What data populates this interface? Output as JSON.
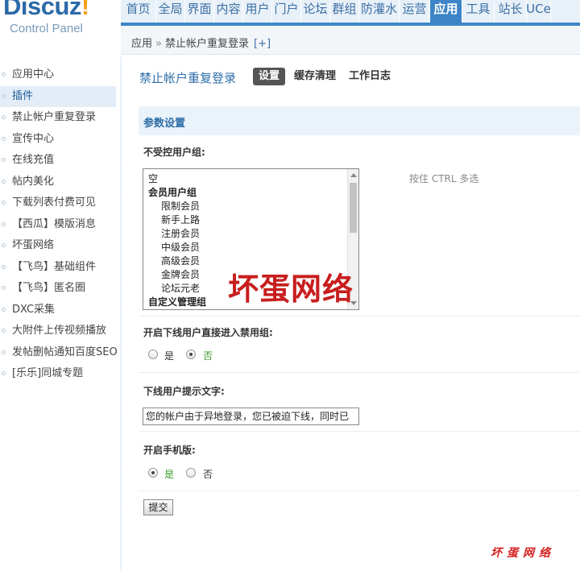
{
  "logo": {
    "brand": "Discuz",
    "brand_mark": "!",
    "subtitle": "Control Panel"
  },
  "nav": {
    "items": [
      "首页",
      "全局",
      "界面",
      "内容",
      "用户",
      "门户",
      "论坛",
      "群组",
      "防灌水",
      "运营",
      "应用",
      "工具",
      "站长",
      "UCe"
    ],
    "active": "应用"
  },
  "breadcrumb": {
    "root": "应用",
    "sep": "»",
    "current": "禁止帐户重复登录",
    "add": "[+]"
  },
  "sidebar": {
    "items": [
      "应用中心",
      "插件",
      "禁止帐户重复登录",
      "宣传中心",
      "在线充值",
      "帖内美化",
      "下载列表付费可见",
      "【西瓜】模版消息",
      "坏蛋网络",
      "【飞鸟】基础组件",
      "【飞鸟】匿名圈",
      "DXC采集",
      "大附件上传视频播放",
      "发帖删帖通知百度SEO",
      "[乐乐]同城专题"
    ],
    "active": "插件"
  },
  "page": {
    "title": "禁止帐户重复登录",
    "tabs": [
      "设置",
      "缓存清理",
      "工作日志"
    ],
    "active_tab": "设置"
  },
  "section": {
    "title": "参数设置"
  },
  "form": {
    "uncontrolled_groups": {
      "label": "不受控用户组:",
      "options": [
        {
          "text": "空",
          "kind": "item"
        },
        {
          "text": "会员用户组",
          "kind": "group"
        },
        {
          "text": "限制会员",
          "kind": "sub"
        },
        {
          "text": "新手上路",
          "kind": "sub"
        },
        {
          "text": "注册会员",
          "kind": "sub"
        },
        {
          "text": "中级会员",
          "kind": "sub"
        },
        {
          "text": "高级会员",
          "kind": "sub"
        },
        {
          "text": "金牌会员",
          "kind": "sub"
        },
        {
          "text": "论坛元老",
          "kind": "sub"
        },
        {
          "text": "自定义管理组",
          "kind": "group"
        }
      ],
      "hint": "按住 CTRL 多选"
    },
    "offline_ban": {
      "label": "开启下线用户直接进入禁用组:",
      "yes": "是",
      "no": "否",
      "selected": "no"
    },
    "offline_tip": {
      "label": "下线用户提示文字:",
      "value": "您的帐户由于异地登录，您已被迫下线，同时已"
    },
    "mobile": {
      "label": "开启手机版:",
      "yes": "是",
      "no": "否",
      "selected": "yes"
    },
    "submit": "提交"
  },
  "watermark": {
    "big": "坏蛋网络",
    "small": "坏蛋网络"
  },
  "colors": {
    "accent": "#3d85c6",
    "selected_option": "#3a9a2a",
    "watermark": "#c81e1e"
  }
}
